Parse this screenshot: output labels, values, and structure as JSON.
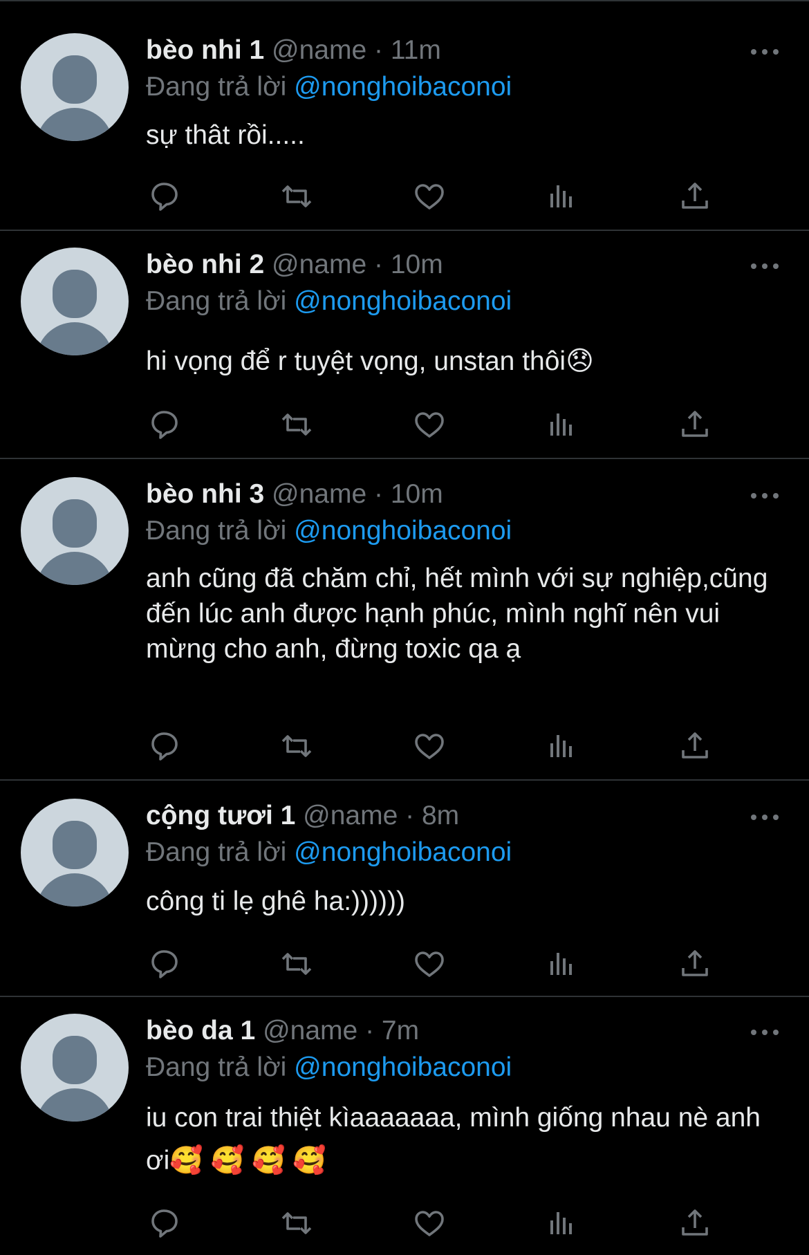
{
  "theme": {
    "background": "#000000",
    "text": "#e7e9ea",
    "muted": "#71767b",
    "accent": "#1d9bf0",
    "divider": "#2f3336"
  },
  "tweets": [
    {
      "name": "bèo nhi 1",
      "handle": "@name",
      "time": "· 11m",
      "replying_label": "Đang trả lời",
      "mention": "@nonghoibaconoi",
      "text": "sự thât rồi....."
    },
    {
      "name": "bèo nhi 2",
      "handle": "@name",
      "time": "· 10m",
      "replying_label": "Đang trả lời",
      "mention": "@nonghoibaconoi",
      "text": "hi vọng để r tuyệt vọng, unstan thôi😞"
    },
    {
      "name": "bèo nhi 3",
      "handle": "@name",
      "time": "· 10m",
      "replying_label": "Đang trả lời",
      "mention": "@nonghoibaconoi",
      "text": "anh cũng đã chăm chỉ, hết mình với sự nghiệp,cũng đến lúc anh được hạnh phúc, mình nghĩ nên vui mừng cho anh, đừng toxic qa ạ"
    },
    {
      "name": "cộng tươi 1",
      "handle": "@name",
      "time": "· 8m",
      "replying_label": "Đang trả lời",
      "mention": "@nonghoibaconoi",
      "text": "công ti lẹ ghê ha:))))))"
    },
    {
      "name": "bèo da 1",
      "handle": "@name",
      "time": "· 7m",
      "replying_label": "Đang trả lời",
      "mention": "@nonghoibaconoi",
      "text": "iu con trai thiệt kìaaaaaaa, mình giống nhau nè anh ơi🥰 🥰 🥰 🥰"
    }
  ],
  "icons": [
    "more-icon",
    "reply-icon",
    "retweet-icon",
    "like-icon",
    "views-icon",
    "share-icon"
  ]
}
